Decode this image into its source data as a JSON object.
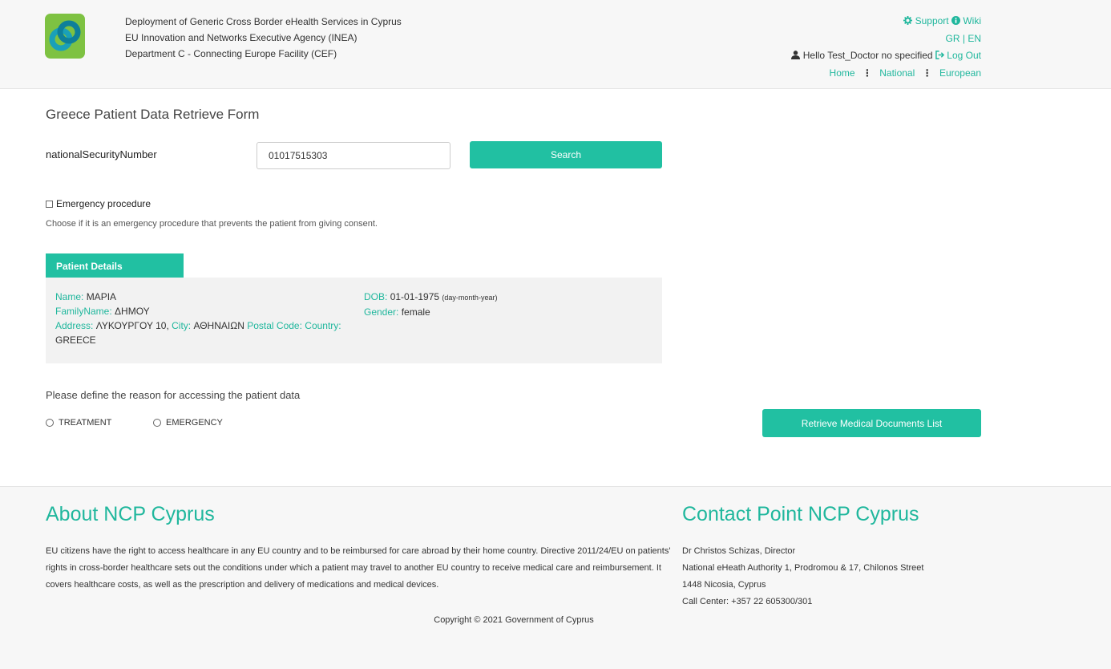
{
  "header": {
    "org_lines": [
      "Deployment of Generic Cross Border eHealth Services in Cyprus",
      "EU Innovation and Networks Executive Agency (INEA)",
      "Department C - Connecting Europe Facility (CEF)"
    ],
    "support_label": "Support",
    "wiki_label": "Wiki",
    "lang_gr": "GR",
    "lang_sep": "|",
    "lang_en": "EN",
    "greeting": "Hello Test_Doctor no specified",
    "logout_label": "Log Out",
    "nav": [
      "Home",
      "National",
      "European"
    ]
  },
  "form": {
    "title": "Greece Patient Data Retrieve Form",
    "field_label": "nationalSecurityNumber",
    "field_value": "01017515303",
    "search_label": "Search",
    "emergency_label": "Emergency procedure",
    "emergency_help": "Choose if it is an emergency procedure that prevents the patient from giving consent."
  },
  "patient": {
    "tab_label": "Patient Details",
    "name_label": "Name:",
    "name_value": "ΜΑΡΙΑ",
    "family_label": "FamilyName:",
    "family_value": "ΔΗΜΟΥ",
    "address_label": "Address:",
    "address_value": "ΛΥΚΟΥΡΓΟΥ 10,",
    "city_label": "City:",
    "city_value": "ΑΘΗΝΑΙΩΝ",
    "postal_label": "Postal Code:",
    "country_label": "Country:",
    "country_value": "GREECE",
    "dob_label": "DOB:",
    "dob_value": "01-01-1975",
    "dob_format": "(day-month-year)",
    "gender_label": "Gender:",
    "gender_value": "female"
  },
  "reason": {
    "title": "Please define the reason for accessing the patient data",
    "options": [
      "TREATMENT",
      "EMERGENCY"
    ],
    "retrieve_label": "Retrieve Medical Documents List"
  },
  "footer": {
    "about_title": "About NCP Cyprus",
    "about_text": "EU citizens have the right to access healthcare in any EU country and to be reimbursed for care abroad by their home country. Directive 2011/24/EU on patients' rights in cross-border healthcare sets out the conditions under which a patient may travel to another EU country to receive medical care and reimbursement. It covers healthcare costs, as well as the prescription and delivery of medications and medical devices.",
    "contact_title": "Contact Point NCP Cyprus",
    "contact_lines": [
      "Dr Christos Schizas, Director",
      "National eHeath Authority 1, Prodromou & 17, Chilonos Street",
      "1448 Nicosia, Cyprus",
      "Call Center: +357 22 605300/301"
    ],
    "copyright": "Copyright © 2021 Government of Cyprus"
  },
  "colors": {
    "accent": "#21c0a2",
    "link": "#20b79d",
    "logo_bg": "#7ec242"
  },
  "icons": [
    "logo-icon",
    "gear-icon",
    "info-icon",
    "user-icon",
    "logout-icon"
  ]
}
